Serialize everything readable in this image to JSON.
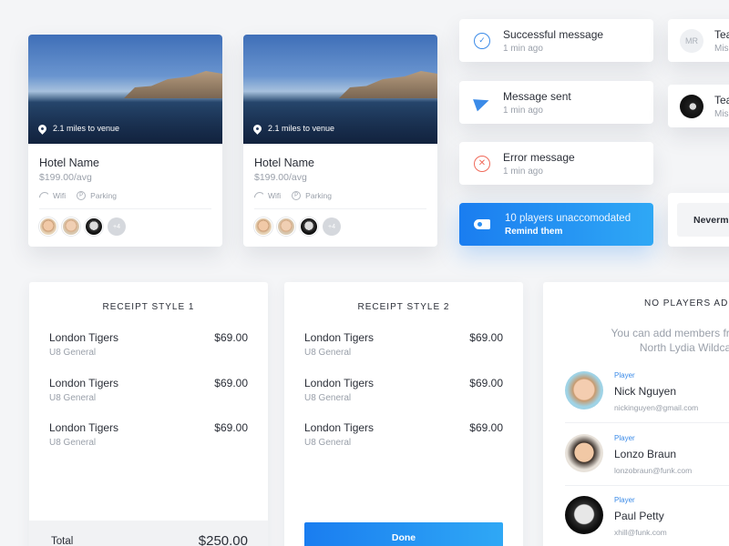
{
  "hotels": [
    {
      "distance": "2.1 miles to venue",
      "name": "Hotel Name",
      "price": "$199.00/avg",
      "wifi": "Wifi",
      "parking": "Parking",
      "parking_letter": "P",
      "more": "+4"
    },
    {
      "distance": "2.1 miles to venue",
      "name": "Hotel Name",
      "price": "$199.00/avg",
      "wifi": "Wifi",
      "parking": "Parking",
      "parking_letter": "P",
      "more": "+4"
    }
  ],
  "notifications": [
    {
      "title": "Successful message",
      "time": "1 min ago",
      "icon": "check-icon"
    },
    {
      "title": "Message sent",
      "time": "1 min ago",
      "icon": "paper-plane-icon"
    },
    {
      "title": "Error message",
      "time": "1 min ago",
      "icon": "close-icon"
    }
  ],
  "promo": {
    "title": "10 players unaccomodated",
    "action": "Remind them"
  },
  "edge": {
    "card1": {
      "initials": "MR",
      "title": "Tea",
      "sub": "Mis"
    },
    "card2": {
      "title": "Tea",
      "sub": "Mis"
    },
    "button": "Neverm"
  },
  "receipts": [
    {
      "title": "RECEIPT STYLE 1",
      "items": [
        {
          "name": "London Tigers",
          "sub": "U8 General",
          "price": "$69.00"
        },
        {
          "name": "London Tigers",
          "sub": "U8 General",
          "price": "$69.00"
        },
        {
          "name": "London Tigers",
          "sub": "U8 General",
          "price": "$69.00"
        }
      ],
      "total_label": "Total",
      "total_value": "$250.00"
    },
    {
      "title": "RECEIPT STYLE 2",
      "items": [
        {
          "name": "London Tigers",
          "sub": "U8 General",
          "price": "$69.00"
        },
        {
          "name": "London Tigers",
          "sub": "U8 General",
          "price": "$69.00"
        },
        {
          "name": "London Tigers",
          "sub": "U8 General",
          "price": "$69.00"
        }
      ],
      "button": "Done"
    }
  ],
  "players": {
    "title": "NO PLAYERS ADDE",
    "desc_line1": "You can add members from yo",
    "desc_line2": "North Lydia Wildca",
    "list": [
      {
        "role": "Player",
        "name": "Nick Nguyen",
        "email": "nickinguyen@gmail.com"
      },
      {
        "role": "Player",
        "name": "Lonzo Braun",
        "email": "lonzobraun@funk.com"
      },
      {
        "role": "Player",
        "name": "Paul Petty",
        "email": "xhill@funk.com"
      }
    ]
  },
  "colors": {
    "accent": "#1a7df0",
    "error": "#f06a5a",
    "background": "#f4f5f7"
  }
}
